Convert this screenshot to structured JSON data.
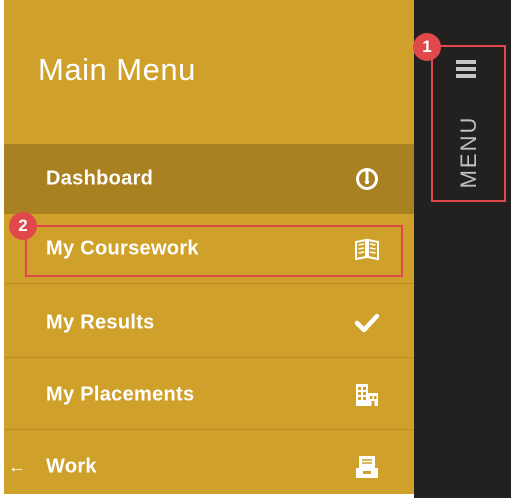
{
  "menu": {
    "title": "Main Menu",
    "items": [
      {
        "label": "Dashboard",
        "icon": "gauge-icon",
        "active": true
      },
      {
        "label": "My Coursework",
        "icon": "open-book-icon",
        "active": false
      },
      {
        "label": "My Results",
        "icon": "checkmark-icon",
        "active": false
      },
      {
        "label": "My Placements",
        "icon": "buildings-icon",
        "active": false
      },
      {
        "label": "Work",
        "icon": "inbox-tray-icon",
        "active": false,
        "back_arrow": "←"
      }
    ]
  },
  "rail": {
    "menu_label": "MENU",
    "icon": "hamburger-icon"
  },
  "annotations": [
    {
      "number": "1"
    },
    {
      "number": "2"
    }
  ],
  "colors": {
    "menu_bg": "#cfa12b",
    "active_item_bg": "#a98120",
    "rail_bg": "#232020",
    "annotation": "#e0484b"
  }
}
